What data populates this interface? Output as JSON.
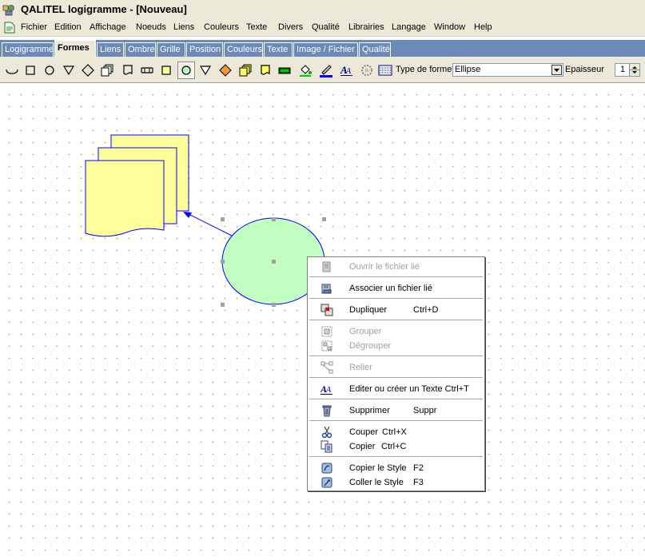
{
  "window": {
    "title": "QALITEL logigramme - [Nouveau]"
  },
  "menubar": {
    "items": [
      "Fichier",
      "Edition",
      "Affichage",
      "Noeuds",
      "Liens",
      "Couleurs",
      "Texte",
      "Divers",
      "Qualité",
      "Librairies",
      "Langage",
      "Window",
      "Help"
    ]
  },
  "tabs": [
    "Logigramme",
    "Formes",
    "Liens",
    "Ombre",
    "Grille",
    "Position",
    "Couleurs",
    "Texte",
    "Image / Fichier",
    "Qualité"
  ],
  "active_tab": "Formes",
  "toolbar": {
    "shape_icons": [
      "arc-shape-icon",
      "rectangle-shape-icon",
      "circle-shape-icon",
      "triangle-down-shape-icon",
      "diamond-shape-icon",
      "stack-shape-icon",
      "document-shape-icon",
      "terminal-shape-icon",
      "square-shape-icon",
      "ellipse-shape-icon",
      "funnel-shape-icon",
      "orange-diamond-icon",
      "yellow-stack-icon",
      "yellow-document-icon",
      "battery-icon",
      "fill-bucket-icon",
      "pen-icon",
      "text-style-icon",
      "gear-icon",
      "pattern-icon"
    ],
    "type_label": "Type de forme",
    "type_value": "Ellipse",
    "thickness_label": "Epaisseur",
    "thickness_value": "1"
  },
  "canvas": {
    "shapes": [
      {
        "type": "multi-document",
        "fill": "#ffff99",
        "stroke": "#0000ff"
      },
      {
        "type": "ellipse",
        "fill": "#c0ffc0",
        "stroke": "#0000ff",
        "selected": true
      },
      {
        "type": "arrow-link",
        "stroke": "#0000ff"
      }
    ]
  },
  "context_menu": {
    "items": [
      {
        "label": "Ouvrir le fichier lié",
        "shortcut": "",
        "enabled": false,
        "icon": "open-file-icon"
      },
      {
        "label": "Associer un fichier lié",
        "shortcut": "",
        "enabled": true,
        "icon": "link-file-icon"
      },
      {
        "label": "Dupliquer",
        "shortcut": "Ctrl+D",
        "enabled": true,
        "icon": "duplicate-icon"
      },
      {
        "label": "Grouper",
        "shortcut": "",
        "enabled": false,
        "icon": "group-icon"
      },
      {
        "label": "Dégrouper",
        "shortcut": "",
        "enabled": false,
        "icon": "ungroup-icon"
      },
      {
        "label": "Relier",
        "shortcut": "",
        "enabled": false,
        "icon": "connect-icon"
      },
      {
        "label": "Editer ou créer un Texte Ctrl+T",
        "shortcut": "",
        "enabled": true,
        "icon": "edit-text-icon"
      },
      {
        "label": "Supprimer",
        "shortcut": "Suppr",
        "enabled": true,
        "icon": "delete-icon"
      },
      {
        "label": "Couper",
        "shortcut": "Ctrl+X",
        "enabled": true,
        "icon": "cut-icon"
      },
      {
        "label": "Copier",
        "shortcut": "Ctrl+C",
        "enabled": true,
        "icon": "copy-icon"
      },
      {
        "label": "Copier le Style",
        "shortcut": "F2",
        "enabled": true,
        "icon": "copy-style-icon"
      },
      {
        "label": "Coller le Style",
        "shortcut": "F3",
        "enabled": true,
        "icon": "paste-style-icon"
      }
    ]
  }
}
